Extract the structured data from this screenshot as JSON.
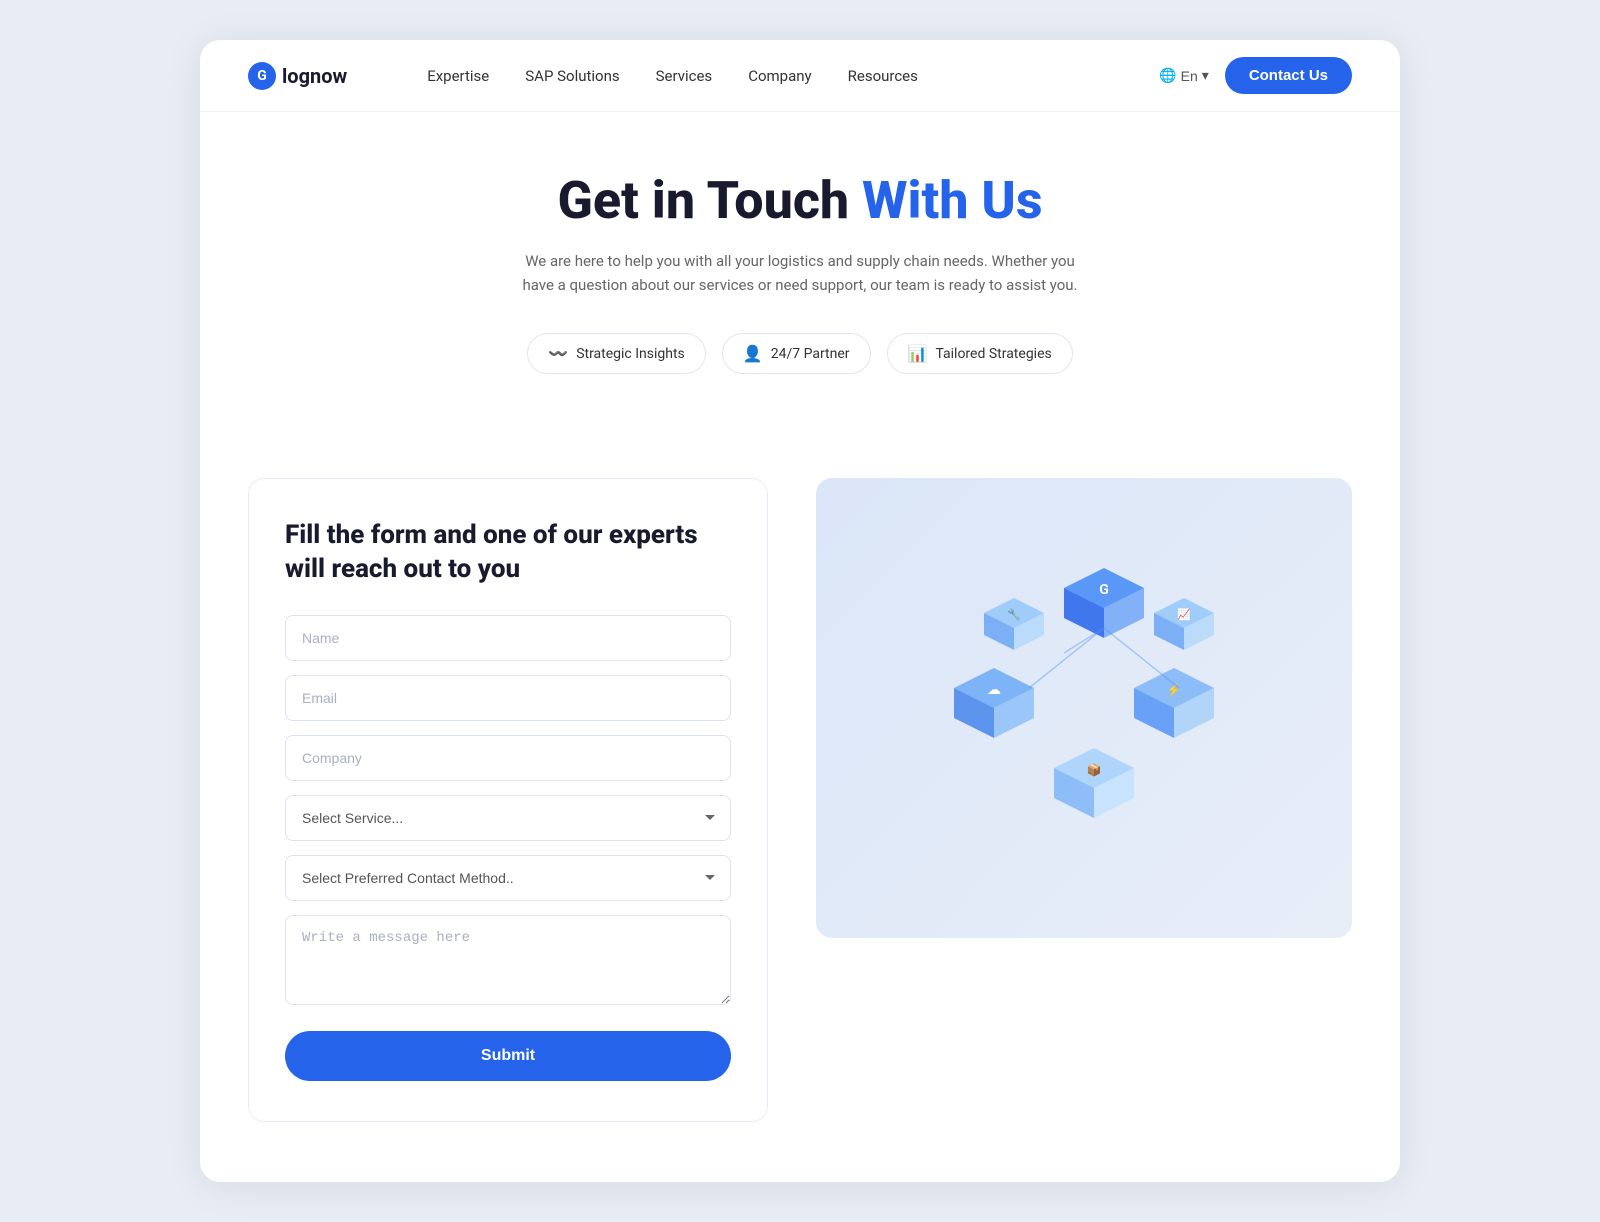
{
  "navbar": {
    "logo_text": "lognow",
    "logo_icon": "G",
    "links": [
      "Expertise",
      "SAP Solutions",
      "Services",
      "Company",
      "Resources"
    ],
    "lang": "En",
    "contact_label": "Contact Us"
  },
  "hero": {
    "title_part1": "Get in Touch ",
    "title_part2": "With Us",
    "subtitle": "We are here to help you with all your logistics and supply chain needs. Whether you have a question about our services or need support, our team is ready to assist you."
  },
  "badges": [
    {
      "icon": "📈",
      "label": "Strategic Insights"
    },
    {
      "icon": "👤",
      "label": "24/7 Partner"
    },
    {
      "icon": "📊",
      "label": "Tailored Strategies"
    }
  ],
  "form": {
    "title": "Fill the form and one of our experts will reach out to you",
    "name_placeholder": "Name",
    "email_placeholder": "Email",
    "company_placeholder": "Company",
    "service_placeholder": "Select Service...",
    "contact_placeholder": "Select Preferred Contact Method..",
    "message_placeholder": "Write a message here",
    "submit_label": "Submit"
  }
}
